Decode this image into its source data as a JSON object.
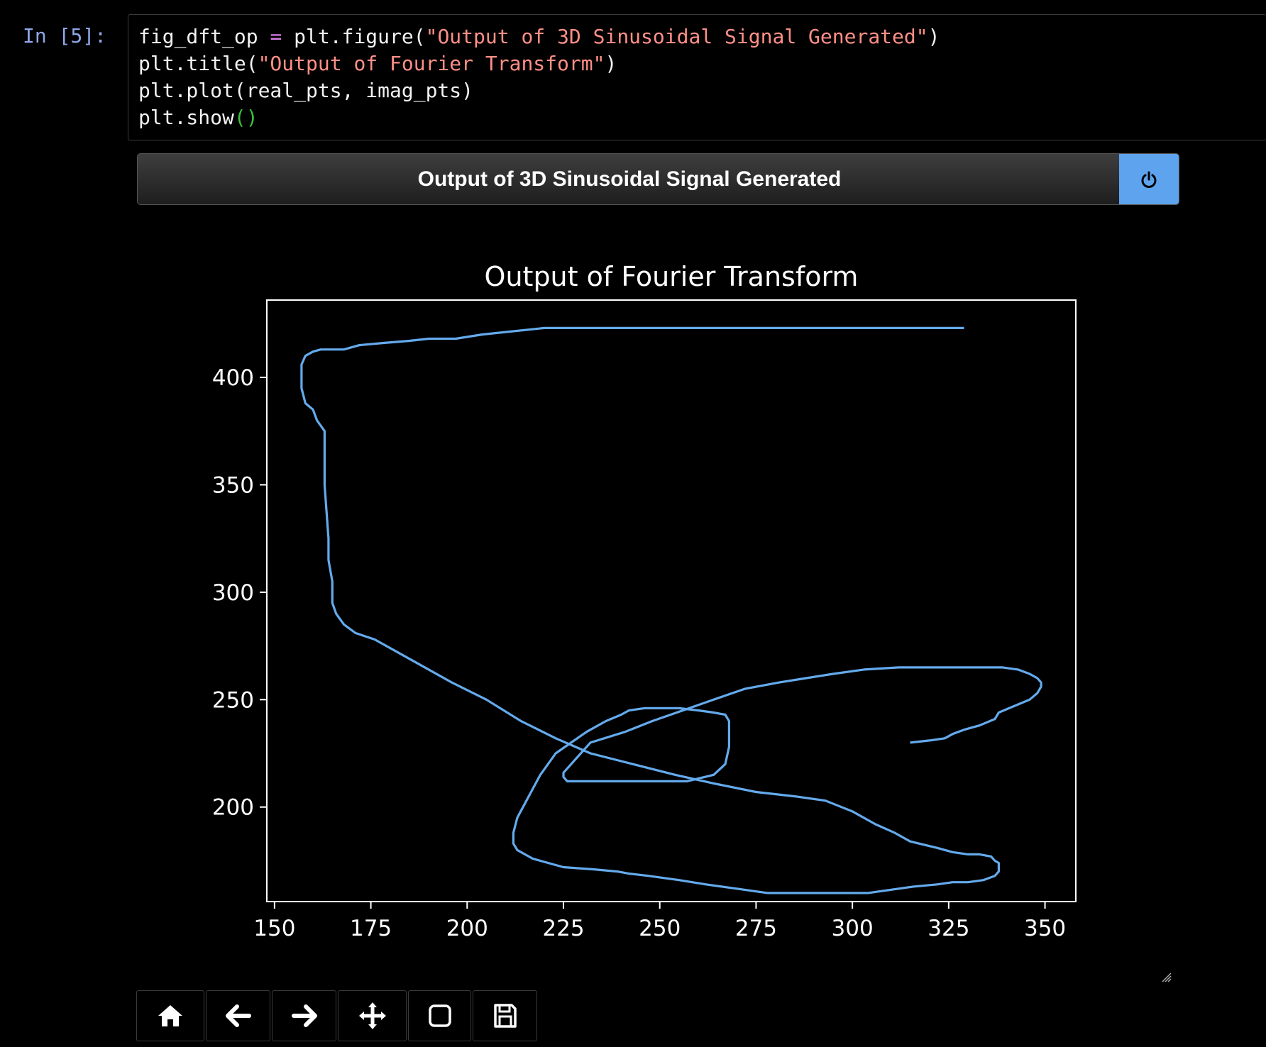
{
  "cell": {
    "prompt": "In [5]:",
    "code": {
      "l1_a": "fig_dft_op ",
      "l1_op": "=",
      "l1_b": " plt.figure(",
      "l1_str": "\"Output of 3D Sinusoidal Signal Generated\"",
      "l1_c": ")",
      "l2_a": "plt.title(",
      "l2_str": "\"Output of Fourier Transform\"",
      "l2_c": ")",
      "l3": "plt.plot(real_pts, imag_pts)",
      "l4_a": "plt.show",
      "l4_paren": "()"
    }
  },
  "figure": {
    "window_title": "Output of 3D Sinusoidal Signal Generated",
    "close_icon": "power-icon",
    "toolbar": [
      {
        "name": "home",
        "icon": "home-icon"
      },
      {
        "name": "back",
        "icon": "arrow-left-icon"
      },
      {
        "name": "forward",
        "icon": "arrow-right-icon"
      },
      {
        "name": "pan",
        "icon": "move-icon"
      },
      {
        "name": "zoom",
        "icon": "square-icon"
      },
      {
        "name": "save",
        "icon": "floppy-icon"
      }
    ]
  },
  "chart_data": {
    "type": "line",
    "title": "Output of Fourier Transform",
    "xlabel": "",
    "ylabel": "",
    "xlim": [
      148,
      358
    ],
    "ylim": [
      156,
      436
    ],
    "xticks": [
      150,
      175,
      200,
      225,
      250,
      275,
      300,
      325,
      350
    ],
    "yticks": [
      200,
      250,
      300,
      350,
      400
    ],
    "grid": false,
    "line_color": "#64aaec",
    "background": "#000000",
    "series": [
      {
        "x": [
          329,
          316,
          300,
          284,
          268,
          252,
          236,
          220,
          204,
          197,
          193,
          190,
          185,
          178,
          172,
          168,
          165,
          162,
          160,
          158,
          157,
          157,
          157,
          158,
          160,
          161,
          163,
          163,
          164,
          164,
          165,
          165,
          166,
          168,
          171,
          176,
          184,
          196,
          205,
          214,
          223,
          232,
          243,
          254,
          264,
          275,
          285,
          293,
          300,
          306,
          311,
          315,
          322,
          326,
          330,
          333,
          336,
          337,
          338,
          338,
          338,
          337,
          334,
          330,
          326,
          322,
          316,
          312,
          304,
          296,
          287,
          278,
          270,
          262,
          255,
          247,
          242,
          239,
          233,
          225,
          221,
          217,
          215,
          213,
          212,
          212,
          213,
          216,
          219,
          223,
          231,
          236,
          240,
          242,
          246,
          251,
          255,
          260,
          264,
          267,
          268,
          268,
          268,
          267,
          264,
          257,
          254,
          250,
          246,
          238,
          233,
          229,
          226,
          225,
          225,
          227,
          229,
          232,
          241,
          248,
          256,
          264,
          272,
          281,
          288,
          295,
          303,
          312,
          320,
          330,
          337,
          339,
          343,
          346,
          348,
          349,
          349,
          348,
          346,
          342,
          338,
          337,
          333,
          329,
          326,
          325,
          324,
          320,
          315
        ],
        "y": [
          423,
          423,
          423,
          423,
          423,
          423,
          423,
          423,
          420,
          418,
          418,
          418,
          417,
          416,
          415,
          413,
          413,
          413,
          412,
          410,
          406,
          400,
          395,
          388,
          385,
          380,
          375,
          350,
          325,
          315,
          305,
          295,
          290,
          285,
          281,
          278,
          270,
          258,
          250,
          240,
          232,
          225,
          220,
          215,
          211,
          207,
          205,
          203,
          198,
          192,
          188,
          184,
          181,
          179,
          178,
          178,
          177,
          175,
          174,
          172,
          170,
          168,
          166,
          165,
          165,
          164,
          163,
          162,
          160,
          160,
          160,
          160,
          162,
          164,
          166,
          168,
          169,
          170,
          171,
          172,
          174,
          176,
          178,
          180,
          183,
          188,
          195,
          205,
          215,
          225,
          235,
          240,
          243,
          245,
          246,
          246,
          246,
          245,
          244,
          243,
          240,
          235,
          228,
          220,
          215,
          212,
          212,
          212,
          212,
          212,
          212,
          212,
          212,
          214,
          216,
          220,
          224,
          230,
          235,
          240,
          245,
          250,
          255,
          258,
          260,
          262,
          264,
          265,
          265,
          265,
          265,
          265,
          264,
          262,
          260,
          258,
          256,
          253,
          250,
          247,
          244,
          241,
          238,
          236,
          234,
          233,
          232,
          231,
          230
        ]
      }
    ]
  }
}
